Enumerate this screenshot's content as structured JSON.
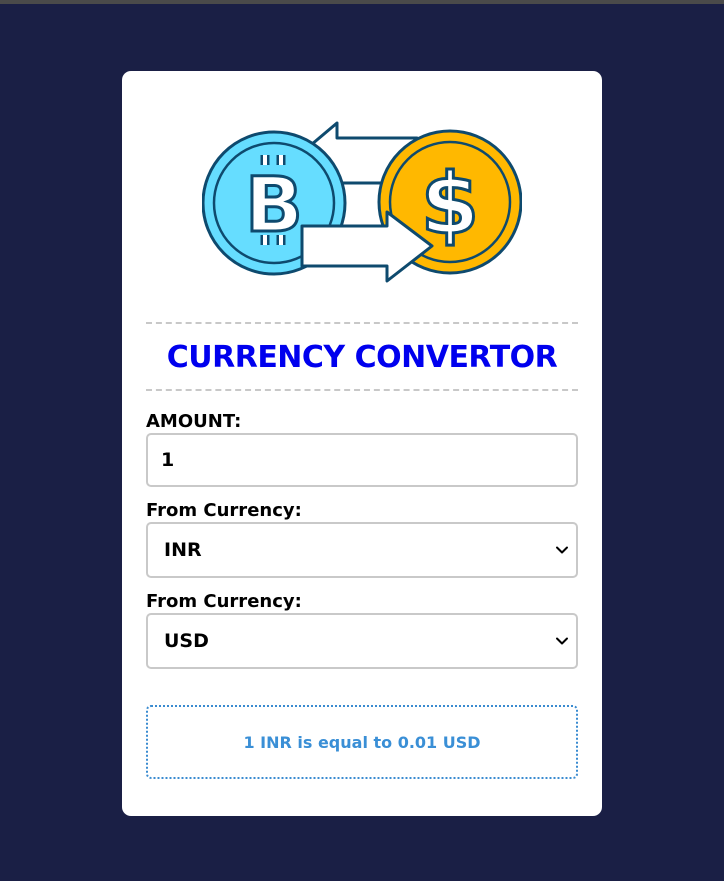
{
  "header": {
    "title": "CURRENCY CONVERTOR"
  },
  "amount": {
    "label": "AMOUNT:",
    "value": "1"
  },
  "from_currency": {
    "label": "From Currency:",
    "selected": "INR"
  },
  "to_currency": {
    "label": "From Currency:",
    "selected": "USD"
  },
  "result": {
    "text": "1 INR is equal to 0.01 USD"
  },
  "logo": {
    "left_symbol": "B",
    "right_symbol": "$"
  },
  "colors": {
    "background": "#1a1f45",
    "title": "#0000ee",
    "result_text": "#3a8fd6",
    "bitcoin_coin": "#66ddff",
    "dollar_coin": "#ffb800"
  }
}
